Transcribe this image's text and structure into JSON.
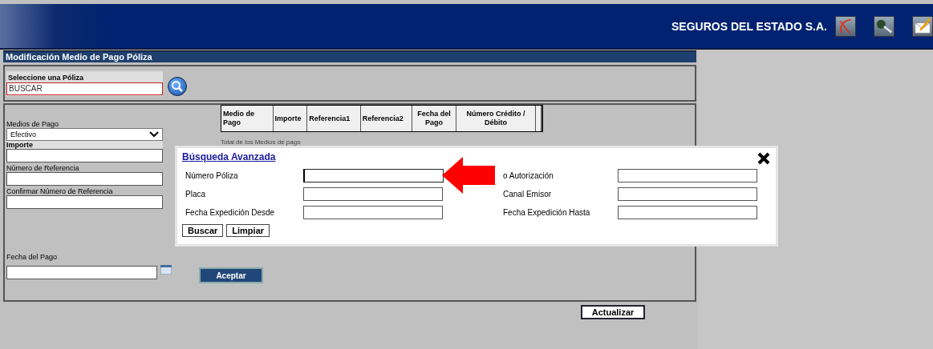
{
  "header": {
    "company": "SEGUROS DEL ESTADO S.A."
  },
  "page": {
    "title": "Modificación Medio de Pago Póliza"
  },
  "policy_search": {
    "label": "Seleccione una Póliza",
    "value": "BUSCAR"
  },
  "payment_form": {
    "medios_label": "Medios de Pago",
    "medios_value": "Efectivo",
    "fields": [
      {
        "label": "Importe",
        "bold": true
      },
      {
        "label": "Número de Referencia",
        "bold": false
      },
      {
        "label": "Confirmar Número de Referencia",
        "bold": false
      }
    ],
    "date_label": "Fecha del Pago",
    "accept": "Aceptar"
  },
  "table": {
    "columns": [
      "Medio de Pago",
      "Importe",
      "Referencia1",
      "Referencia2",
      "Fecha del Pago",
      "Número Crédito / Débito"
    ],
    "total_label": "Total de los Medios de pago"
  },
  "update_button": "Actualizar",
  "advanced_search": {
    "title": "Búsqueda Avanzada",
    "left_fields": [
      {
        "label": "Número Póliza",
        "focused": true
      },
      {
        "label": "Placa",
        "focused": false
      },
      {
        "label": "Fecha Expedición Desde",
        "focused": false
      }
    ],
    "right_fields": [
      {
        "label": "o Autorización",
        "focused": false
      },
      {
        "label": "Canal Emisor",
        "focused": false
      },
      {
        "label": "Fecha Expedición Hasta",
        "focused": false
      }
    ],
    "buttons": [
      "Buscar",
      "Limpiar"
    ]
  }
}
